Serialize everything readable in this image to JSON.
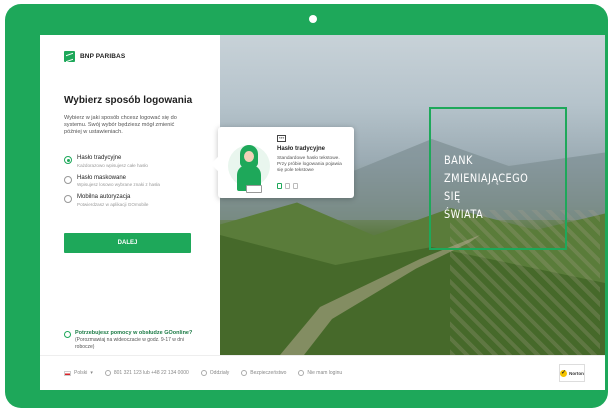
{
  "brand": {
    "name": "BNP PARIBAS",
    "accent": "#1ea85a"
  },
  "login": {
    "heading": "Wybierz sposób logowania",
    "intro": "Wybierz w jaki sposób chcesz logować się do systemu. Swój wybór będziesz mógł zmienić później w ustawieniach.",
    "options": [
      {
        "label": "Hasło tradycyjne",
        "desc": "Każdorazowo wpisujesz całe hasło",
        "selected": true
      },
      {
        "label": "Hasło maskowane",
        "desc": "Wpisujesz losowo wybrane znaki z hasła",
        "selected": false
      },
      {
        "label": "Mobilna autoryzacja",
        "desc": "Potwierdzasz w aplikacji GOmobile",
        "selected": false
      }
    ],
    "submit_label": "DALEJ"
  },
  "help": {
    "link": "Potrzebujesz pomocy w obsłudze GOonline?",
    "text": "(Porozmawiaj na wideoczacie w godz. 9-17 w dni robocze)"
  },
  "popup": {
    "badge": "***",
    "title": "Hasło tradycyjne",
    "desc": "Standardowe hasło tekstowe. Przy próbie logowania pojawia się pole tekstowe",
    "illustration": "woman-with-card-illustration"
  },
  "hero": {
    "lines": [
      "BANK",
      "ZMIENIAJĄCEGO",
      "SIĘ",
      "ŚWIATA"
    ],
    "image": "green-mountain-meadow-photo"
  },
  "footer": {
    "language": "Polski",
    "phone": "801 321 123 lub +48 22 134 0000",
    "branches": "Oddziały",
    "security": "Bezpieczeństwo",
    "no_login": "Nie mam loginu",
    "norton_label": "Norton"
  }
}
